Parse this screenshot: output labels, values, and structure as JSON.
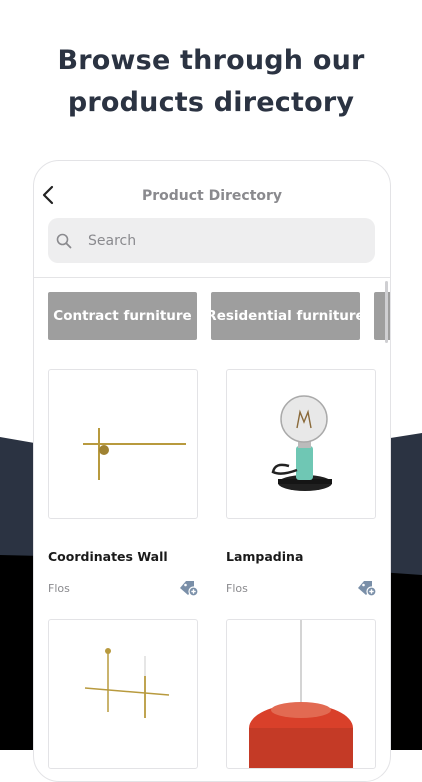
{
  "headline": {
    "line1": "Browse through our",
    "line2": "products directory"
  },
  "nav": {
    "title": "Product Directory",
    "back_icon": "chevron-left-icon"
  },
  "search": {
    "placeholder": "Search",
    "icon": "search-icon"
  },
  "categories": [
    {
      "label": "Contract furniture"
    },
    {
      "label": "Residential furniture"
    }
  ],
  "products": [
    {
      "name": "Coordinates Wall",
      "brand": "Flos",
      "icon": "add-tag-icon"
    },
    {
      "name": "Lampadina",
      "brand": "Flos",
      "icon": "add-tag-icon"
    }
  ],
  "colors": {
    "heading": "#2b3342",
    "chip": "#9e9e9e",
    "tag_icon": "#7a8fa8",
    "lamp_red": "#d9402a",
    "brass": "#b89a3e"
  }
}
